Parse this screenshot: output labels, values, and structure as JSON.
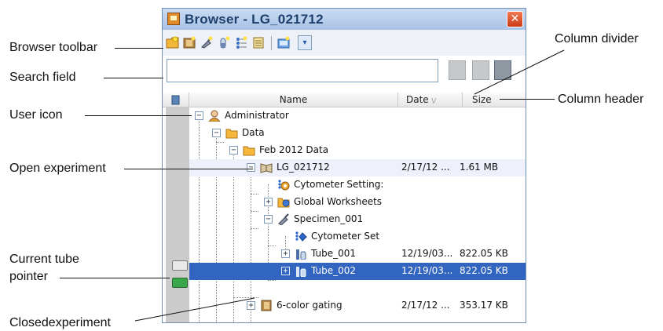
{
  "window": {
    "title": "Browser - LG_021712",
    "close_glyph": "✕"
  },
  "toolbar": {
    "buttons": [
      "new-folder-icon",
      "new-experiment-icon",
      "new-specimen-icon",
      "new-tube-icon",
      "new-global-worksheet-icon",
      "new-sheet-icon",
      "import-icon"
    ],
    "dropdown_glyph": "▾"
  },
  "search": {
    "value": "",
    "placeholder": ""
  },
  "columns": {
    "name": "Name",
    "date": "Date",
    "date_sort_glyph": "\\/",
    "size": "Size"
  },
  "tree": [
    {
      "label": "Administrator",
      "icon": "user-icon",
      "expander": "−",
      "date": "",
      "size": ""
    },
    {
      "label": "Data",
      "icon": "folder-icon",
      "expander": "−",
      "date": "",
      "size": ""
    },
    {
      "label": "Feb 2012 Data",
      "icon": "folder-icon",
      "expander": "−",
      "date": "",
      "size": ""
    },
    {
      "label": "LG_021712",
      "icon": "open-experiment-icon",
      "expander": "−",
      "date": "2/17/12 ...",
      "size": "1.61 MB"
    },
    {
      "label": "Cytometer Setting:",
      "icon": "cytometer-settings-icon",
      "expander": "",
      "date": "",
      "size": ""
    },
    {
      "label": "Global Worksheets",
      "icon": "global-worksheet-icon",
      "expander": "+",
      "date": "",
      "size": ""
    },
    {
      "label": "Specimen_001",
      "icon": "specimen-icon",
      "expander": "−",
      "date": "",
      "size": ""
    },
    {
      "label": "Cytometer Set",
      "icon": "cytometer-settings-icon",
      "expander": "",
      "date": "",
      "size": ""
    },
    {
      "label": "Tube_001",
      "icon": "tube-icon",
      "expander": "+",
      "date": "12/19/03...",
      "size": "822.05 KB"
    },
    {
      "label": "Tube_002",
      "icon": "tube-icon",
      "expander": "+",
      "date": "12/19/03...",
      "size": "822.05 KB"
    },
    {
      "label": "6-color gating",
      "icon": "closed-experiment-icon",
      "expander": "+",
      "date": "2/17/12 ...",
      "size": "353.17 KB"
    }
  ],
  "callouts": {
    "browser_toolbar": "Browser toolbar",
    "search_field": "Search field",
    "user_icon": "User icon",
    "open_experiment": "Open experiment",
    "current_tube_pointer_1": "Current tube",
    "current_tube_pointer_2": "pointer",
    "closed_experiment": "Closedexperiment",
    "column_divider": "Column divider",
    "column_header": "Column header"
  },
  "colors": {
    "selection": "#3165bf",
    "open_experiment_highlight": "#eef0fb",
    "current_pointer": "#3aa84a",
    "title_text": "#1d3f6b",
    "close_button": "#d9512c"
  }
}
